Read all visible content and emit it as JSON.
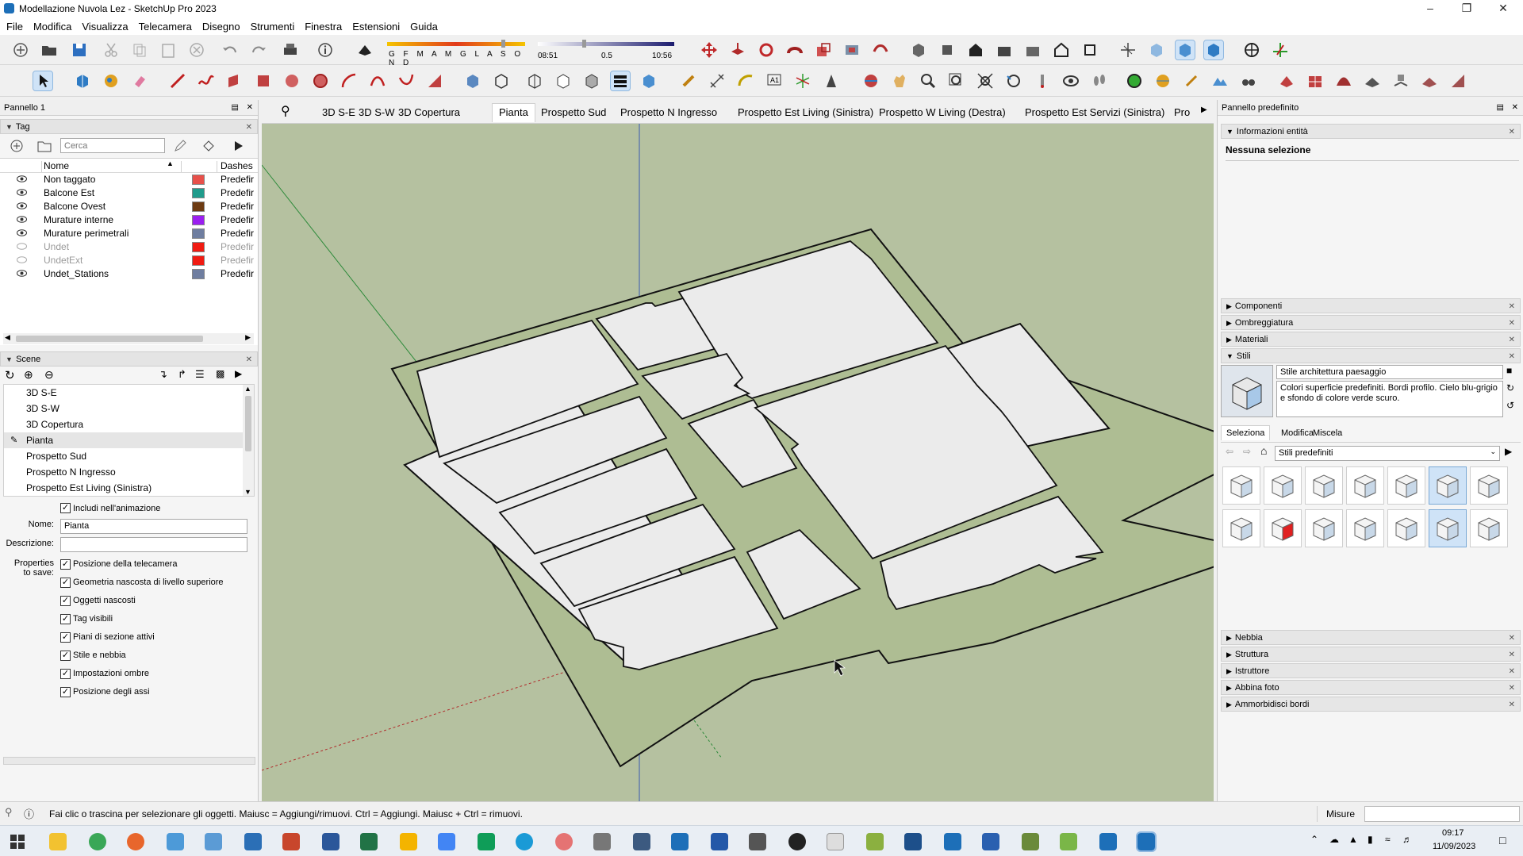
{
  "window": {
    "title": "Modellazione Nuvola Lez - SketchUp Pro 2023"
  },
  "menu": [
    "File",
    "Modifica",
    "Visualizza",
    "Telecamera",
    "Disegno",
    "Strumenti",
    "Finestra",
    "Estensioni",
    "Guida"
  ],
  "shadow_toolbar": {
    "months": "G F M A M G L A S O N D",
    "time_start": "08:51",
    "mid": "0.5",
    "time_end": "10:56"
  },
  "left_panel": {
    "title": "Pannello 1",
    "tag_section": "Tag",
    "search_placeholder": "Cerca",
    "columns": {
      "name": "Nome",
      "dashes": "Dashes"
    },
    "tags": [
      {
        "name": "Non taggato",
        "color": "#e8504a",
        "dashes": "Predefir",
        "visible": true
      },
      {
        "name": "Balcone Est",
        "color": "#1f9c8c",
        "dashes": "Predefir",
        "visible": true
      },
      {
        "name": "Balcone Ovest",
        "color": "#6d3b12",
        "dashes": "Predefir",
        "visible": true
      },
      {
        "name": "Murature interne",
        "color": "#9b1ff0",
        "dashes": "Predefir",
        "visible": true
      },
      {
        "name": "Murature perimetrali",
        "color": "#6f7ea0",
        "dashes": "Predefir",
        "visible": true
      },
      {
        "name": "Undet",
        "color": "#f01b12",
        "dashes": "Predefir",
        "visible": false
      },
      {
        "name": "UndetExt",
        "color": "#f01b12",
        "dashes": "Predefir",
        "visible": false
      },
      {
        "name": "Undet_Stations",
        "color": "#6f7ea0",
        "dashes": "Predefir",
        "visible": true
      }
    ],
    "scene_section": "Scene",
    "scenes": [
      "3D S-E",
      "3D S-W",
      "3D Copertura",
      "Pianta",
      "Prospetto Sud",
      "Prospetto N Ingresso",
      "Prospetto Est Living (Sinistra)"
    ],
    "selected_scene": "Pianta",
    "include_animation": "Includi nell'animazione",
    "name_label": "Nome:",
    "name_value": "Pianta",
    "desc_label": "Descrizione:",
    "desc_value": "",
    "props_label_1": "Properties",
    "props_label_2": "to save:",
    "properties": [
      "Posizione della telecamera",
      "Geometria nascosta di livello superiore",
      "Oggetti nascosti",
      "Tag visibili",
      "Piani di sezione attivi",
      "Stile e nebbia",
      "Impostazioni ombre",
      "Posizione degli assi"
    ]
  },
  "scene_tabs": [
    "3D S-E",
    "3D S-W",
    "3D Copertura",
    "Pianta",
    "Prospetto Sud",
    "Prospetto N Ingresso",
    "Prospetto Est Living (Sinistra)",
    "Prospetto W Living (Destra)",
    "Prospetto Est Servizi (Sinistra)",
    "Pro"
  ],
  "active_scene_tab": "Pianta",
  "right_panel": {
    "title": "Pannello predefinito",
    "entity_info": "Informazioni entità",
    "no_selection": "Nessuna selezione",
    "sections_top": [
      "Componenti",
      "Ombreggiatura",
      "Materiali",
      "Stili"
    ],
    "style_name": "Stile architettura paesaggio",
    "style_desc": "Colori superficie predefiniti. Bordi profilo. Cielo blu-grigio e sfondo di colore verde scuro.",
    "style_tabs": [
      "Seleziona",
      "Modifica",
      "Miscela"
    ],
    "style_collection": "Stili predefiniti",
    "sections_bottom": [
      "Nebbia",
      "Struttura",
      "Istruttore",
      "Abbina foto",
      "Ammorbidisci bordi"
    ]
  },
  "status": {
    "hint": "Fai clic o trascina per selezionare gli oggetti. Maiusc = Aggiungi/rimuovi. Ctrl = Aggiungi. Maiusc + Ctrl = rimuovi.",
    "measure_label": "Misure",
    "measure_value": ""
  },
  "taskbar": {
    "time": "09:17",
    "date": "11/09/2023"
  },
  "colors": {
    "viewport_bg": "#b5c1a0",
    "wall": "#aebd93",
    "floor": "#ebebeb",
    "accent": "#1d6fb8"
  }
}
